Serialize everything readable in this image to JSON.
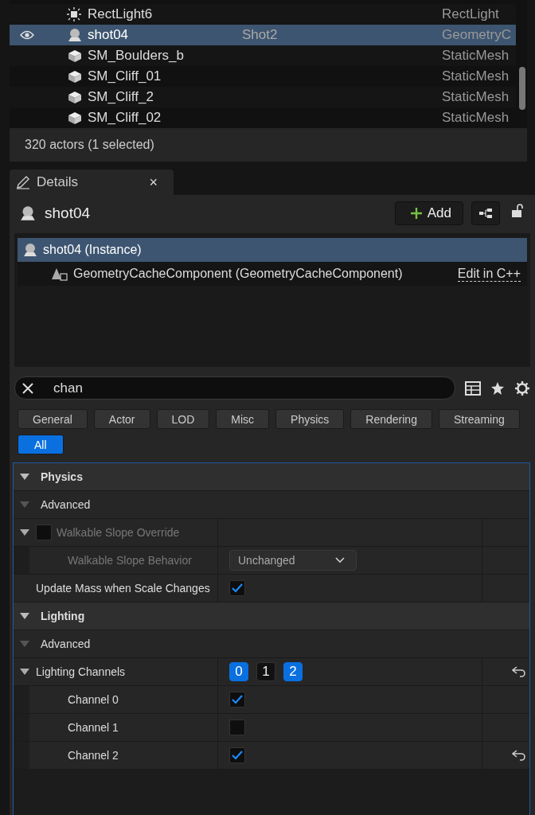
{
  "outliner": {
    "rows": [
      {
        "kind": "light",
        "label": "RectLight6",
        "type": "RectLight",
        "selected": false,
        "visible": false
      },
      {
        "kind": "geometry",
        "label": "shot04",
        "column_2": "Shot2",
        "type": "GeometryC",
        "selected": true,
        "visible": true
      },
      {
        "kind": "mesh",
        "label": "SM_Boulders_b",
        "type": "StaticMesh",
        "selected": false,
        "visible": false
      },
      {
        "kind": "mesh",
        "label": "SM_Cliff_01",
        "type": "StaticMesh",
        "selected": false,
        "visible": false
      },
      {
        "kind": "mesh",
        "label": "SM_Cliff_2",
        "type": "StaticMesh",
        "selected": false,
        "visible": false
      },
      {
        "kind": "mesh",
        "label": "SM_Cliff_02",
        "type": "StaticMesh",
        "selected": false,
        "visible": false
      }
    ],
    "status": "320 actors (1 selected)"
  },
  "details": {
    "tab": {
      "title": "Details",
      "close": "×"
    },
    "actor": "shot04",
    "add_button": "Add",
    "components": [
      {
        "label": "shot04 (Instance)",
        "selected": true,
        "children": [
          {
            "label": "GeometryCacheComponent (GeometryCacheComponent)",
            "link": "Edit in C++",
            "selected": false
          }
        ]
      }
    ],
    "search": {
      "value": "chan"
    },
    "filters": [
      {
        "label": "General",
        "selected": false
      },
      {
        "label": "Actor",
        "selected": false
      },
      {
        "label": "LOD",
        "selected": false
      },
      {
        "label": "Misc",
        "selected": false
      },
      {
        "label": "Physics",
        "selected": false
      },
      {
        "label": "Rendering",
        "selected": false
      },
      {
        "label": "Streaming",
        "selected": false
      },
      {
        "label": "All",
        "selected": true
      }
    ],
    "properties": [
      {
        "kind": "category",
        "label": "Physics",
        "expanded": true
      },
      {
        "kind": "subcategory",
        "label": "Advanced",
        "expanded": true
      },
      {
        "kind": "checkgroup",
        "label": "Walkable Slope Override",
        "checked": false,
        "disabled": true,
        "expanded": true,
        "children": [
          {
            "kind": "dropdown",
            "label": "Walkable Slope Behavior",
            "value": "Unchanged",
            "disabled": true
          }
        ]
      },
      {
        "kind": "checkbox",
        "label": "Update Mass when Scale Changes",
        "checked": true
      },
      {
        "kind": "category",
        "label": "Lighting",
        "expanded": true
      },
      {
        "kind": "subcategory",
        "label": "Advanced",
        "expanded": true
      },
      {
        "kind": "channels",
        "label": "Lighting Channels",
        "expanded": true,
        "resettable": true,
        "channels": [
          {
            "label": "0",
            "selected": true
          },
          {
            "label": "1",
            "selected": false
          },
          {
            "label": "2",
            "selected": true
          }
        ],
        "children": [
          {
            "kind": "checkbox",
            "label": "Channel 0",
            "checked": true
          },
          {
            "kind": "checkbox",
            "label": "Channel 1",
            "checked": false
          },
          {
            "kind": "checkbox",
            "label": "Channel 2",
            "checked": true,
            "resettable": true
          }
        ]
      }
    ]
  }
}
